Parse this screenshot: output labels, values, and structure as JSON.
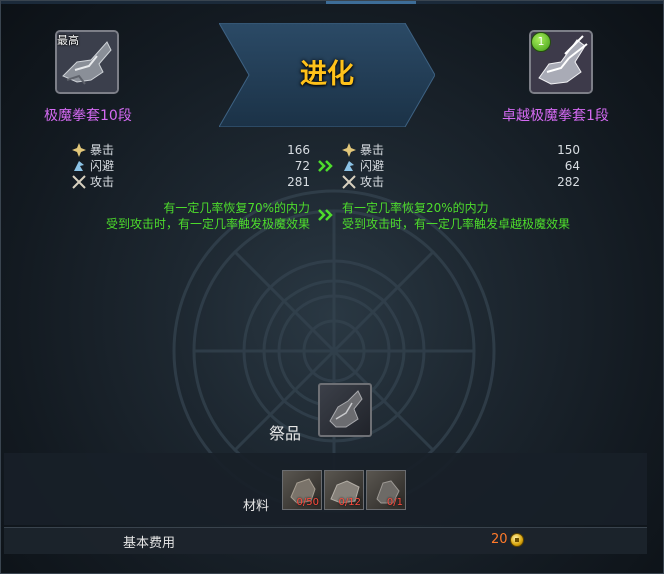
{
  "window": {
    "title": "进化"
  },
  "source_item": {
    "name": "极魔拳套10段",
    "badge": "最高",
    "stats": [
      {
        "icon": "crit-icon",
        "label": "暴击",
        "value": "166"
      },
      {
        "icon": "evade-icon",
        "label": "闪避",
        "value": "72"
      },
      {
        "icon": "attack-icon",
        "label": "攻击",
        "value": "281"
      }
    ],
    "effects": [
      "有一定几率恢复70%的内力",
      "受到攻击时，有一定几率触发极魔效果"
    ]
  },
  "target_item": {
    "name": "卓越极魔拳套1段",
    "badge": "1",
    "stats": [
      {
        "icon": "crit-icon",
        "label": "暴击",
        "value": "150"
      },
      {
        "icon": "evade-icon",
        "label": "闪避",
        "value": "64"
      },
      {
        "icon": "attack-icon",
        "label": "攻击",
        "value": "282"
      }
    ],
    "effects": [
      "有一定几率恢复20%的内力",
      "受到攻击时，有一定几率触发卓越极魔效果"
    ]
  },
  "sacrifice": {
    "label": "祭品"
  },
  "materials": {
    "label": "材料",
    "items": [
      {
        "icon": "ore-icon",
        "count": "0/50"
      },
      {
        "icon": "stone-icon",
        "count": "0/12"
      },
      {
        "icon": "crystal-icon",
        "count": "0/1"
      }
    ]
  },
  "cost": {
    "label": "基本费用",
    "value": "20",
    "currency_icon": "coin-icon"
  },
  "colors": {
    "title": "#ffc21a",
    "item_name": "#d46af2",
    "effect_text": "#4ddc2c",
    "arrow": "#4ddc2c",
    "material_count": "#ff4b3e",
    "cost_value": "#ff7a2a"
  }
}
